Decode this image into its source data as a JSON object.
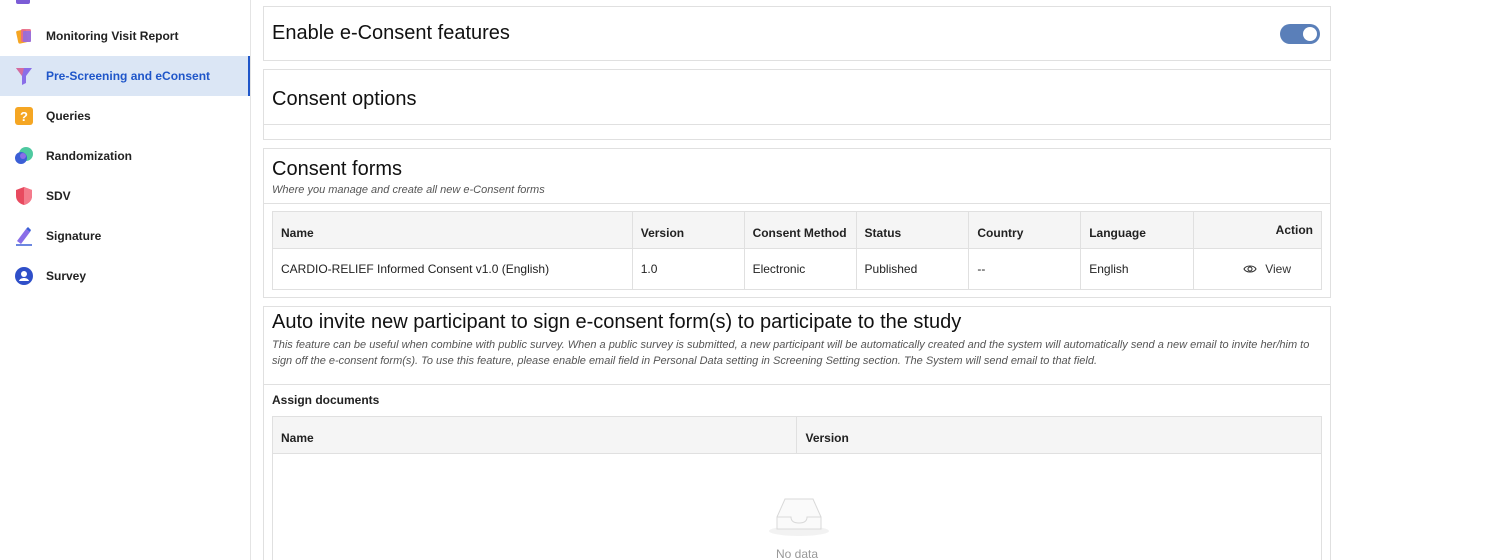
{
  "sidebar": {
    "items": [
      {
        "label": "Monitoring Visit Report",
        "icon": "report-icon"
      },
      {
        "label": "Pre-Screening and eConsent",
        "icon": "funnel-icon",
        "active": true
      },
      {
        "label": "Queries",
        "icon": "question-icon"
      },
      {
        "label": "Randomization",
        "icon": "randomization-icon"
      },
      {
        "label": "SDV",
        "icon": "shield-icon"
      },
      {
        "label": "Signature",
        "icon": "pen-icon"
      },
      {
        "label": "Survey",
        "icon": "person-icon"
      }
    ]
  },
  "enable": {
    "title": "Enable e-Consent features",
    "enabled": true
  },
  "options": {
    "title": "Consent options"
  },
  "forms": {
    "title": "Consent forms",
    "subtitle": "Where you manage and create all new e-Consent forms",
    "columns": [
      "Name",
      "Version",
      "Consent Method",
      "Status",
      "Country",
      "Language",
      "Action"
    ],
    "rows": [
      {
        "name": "CARDIO-RELIEF Informed Consent v1.0 (English)",
        "version": "1.0",
        "method": "Electronic",
        "status": "Published",
        "country": "--",
        "language": "English",
        "action": "View"
      }
    ]
  },
  "auto_invite": {
    "title": "Auto invite new participant to sign e-consent form(s) to participate to the study",
    "description": "This feature can be useful when combine with public survey. When a public survey is submitted, a new participant will be automatically created and the system will automatically send a new email to invite her/him to sign off the e-consent form(s). To use this feature, please enable email field in Personal Data setting in Screening Setting section. The System will send email to that field.",
    "assign_label": "Assign documents",
    "columns": [
      "Name",
      "Version"
    ],
    "empty_text": "No data"
  },
  "colors": {
    "accent": "#1f56c9",
    "active_bg": "#dbe6f5",
    "toggle": "#5a7fb9"
  }
}
